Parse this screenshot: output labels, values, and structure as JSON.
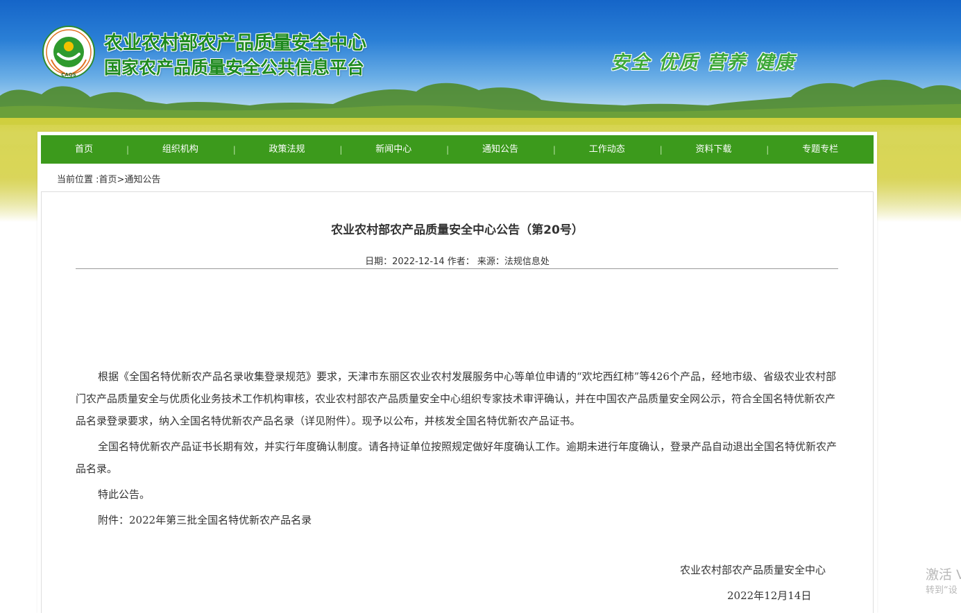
{
  "header": {
    "title_line1": "农业农村部农产品质量安全中心",
    "title_line2": "国家农产品质量安全公共信息平台",
    "slogan": "安全 优质 营养 健康",
    "logo_text": "CAQS",
    "logo_ring_text": "安全 优质 营养 健康",
    "logo_icon": "caqs-logo"
  },
  "nav": {
    "items": [
      {
        "label": "首页"
      },
      {
        "label": "组织机构"
      },
      {
        "label": "政策法规"
      },
      {
        "label": "新闻中心"
      },
      {
        "label": "通知公告"
      },
      {
        "label": "工作动态"
      },
      {
        "label": "资料下载"
      },
      {
        "label": "专题专栏"
      }
    ],
    "separator": "|"
  },
  "breadcrumb": {
    "prefix": "当前位置 :",
    "home": "首页",
    "sep": ">",
    "current": "通知公告"
  },
  "article": {
    "title": "农业农村部农产品质量安全中心公告（第20号）",
    "meta": "日期：2022-12-14 作者：  来源：法规信息处",
    "paragraphs": [
      "根据《全国名特优新农产品名录收集登录规范》要求，天津市东丽区农业农村发展服务中心等单位申请的“欢坨西红柿”等426个产品，经地市级、省级农业农村部门农产品质量安全与优质化业务技术工作机构审核，农业农村部农产品质量安全中心组织专家技术审评确认，并在中国农产品质量安全网公示，符合全国名特优新农产品名录登录要求，纳入全国名特优新农产品名录（详见附件）。现予以公布，并核发全国名特优新农产品证书。",
      "全国名特优新农产品证书长期有效，并实行年度确认制度。请各持证单位按照规定做好年度确认工作。逾期未进行年度确认，登录产品自动退出全国名特优新农产品名录。",
      "特此公告。",
      "附件：2022年第三批全国名特优新农产品名录"
    ],
    "signature": "农业农村部农产品质量安全中心",
    "signature_date": "2022年12月14日"
  },
  "watermark": {
    "line1": "激活 V",
    "line2": "转到“设"
  },
  "colors": {
    "nav_green": "#3c9a1c",
    "title_green": "#1e8a1e",
    "slogan_green": "#3da83a",
    "sky_blue": "#1565c8",
    "field_yellow": "#d6d45a"
  }
}
